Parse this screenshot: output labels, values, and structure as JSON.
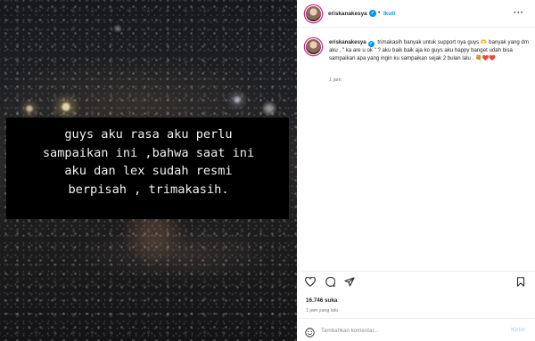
{
  "post": {
    "image_caption": "guys aku rasa aku perlu\nsampaikan ini ,bahwa saat ini\naku dan lex sudah resmi\nberpisah , trimakasih."
  },
  "header": {
    "username": "eriskanakesya",
    "verified_mark": "✓",
    "separator": "•",
    "follow_label": "Ikuti",
    "more_label": "···"
  },
  "caption": {
    "username": "eriskanakesya",
    "text": "trimakasih banyak untuk support nya guys 🫶 banyak yang dm aku , \" ka are u ok \" ? aku baik baik aja ko guys aku happy banget udah bisa sampaikan apa yang ingin ku sampaikan sejak 2 bulan lalu . 💐❤️❤️",
    "time": "1 jam"
  },
  "actions": {
    "icons": [
      "heart-icon",
      "comment-icon",
      "share-icon",
      "bookmark-icon"
    ]
  },
  "likes": "16.746 suka",
  "posted_time": "1 jam yang lalu",
  "comment_box": {
    "placeholder": "Tambahkan komentar...",
    "post_label": "Kirim"
  },
  "colors": {
    "accent": "#0095f6",
    "text": "#262626",
    "muted": "#737373",
    "post_disabled": "#b3dbff"
  }
}
